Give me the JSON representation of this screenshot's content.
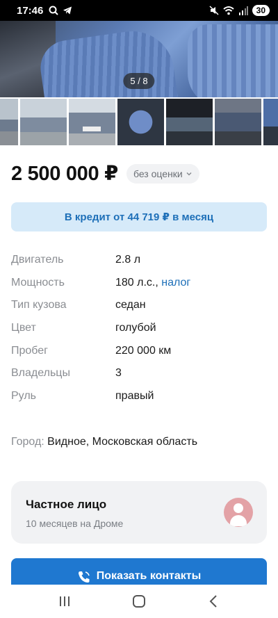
{
  "status_bar": {
    "time": "17:46",
    "battery": "30",
    "icons_left": [
      "search-icon",
      "telegram-icon"
    ],
    "icons_right": [
      "mute-icon",
      "wifi-icon",
      "signal-icon",
      "battery-icon"
    ]
  },
  "gallery": {
    "counter": "5 / 8",
    "thumbnails_count": 7
  },
  "price": {
    "value": "2 500 000 ₽",
    "badge": "без оценки"
  },
  "credit_banner": "В кредит от 44 719 ₽ в месяц",
  "specs": [
    {
      "label": "Двигатель",
      "value": "2.8 л"
    },
    {
      "label": "Мощность",
      "value": "180 л.с.,",
      "link": "налог"
    },
    {
      "label": "Тип кузова",
      "value": "седан"
    },
    {
      "label": "Цвет",
      "value": "голубой"
    },
    {
      "label": "Пробег",
      "value": "220 000 км"
    },
    {
      "label": "Владельцы",
      "value": "3"
    },
    {
      "label": "Руль",
      "value": "правый"
    }
  ],
  "city": {
    "label": "Город:",
    "value": "Видное, Московская область"
  },
  "seller": {
    "name": "Частное лицо",
    "subtitle": "10 месяцев на Дроме"
  },
  "contact_button": "Показать контакты",
  "colors": {
    "accent": "#1f78d0",
    "link": "#1d6fb8",
    "credit_bg": "#d6eaf9",
    "avatar": "#e3a2a6"
  }
}
